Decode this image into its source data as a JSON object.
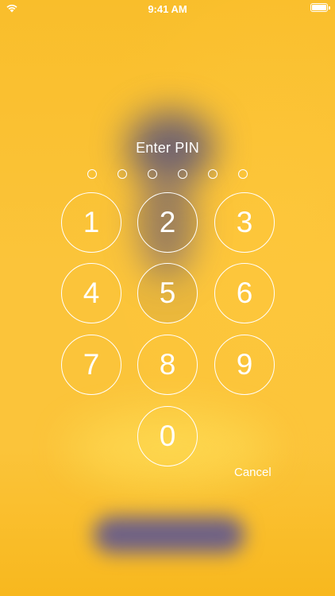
{
  "status_bar": {
    "time": "9:41 AM",
    "wifi_icon": "wifi-icon",
    "battery_icon": "battery-icon"
  },
  "prompt": {
    "title": "Enter PIN",
    "pin_length": 6,
    "entered_digits": 0
  },
  "keypad": {
    "keys": [
      "1",
      "2",
      "3",
      "4",
      "5",
      "6",
      "7",
      "8",
      "9",
      "0"
    ]
  },
  "actions": {
    "cancel_label": "Cancel"
  },
  "colors": {
    "background": "#fbc02d",
    "foreground": "#ffffff"
  }
}
